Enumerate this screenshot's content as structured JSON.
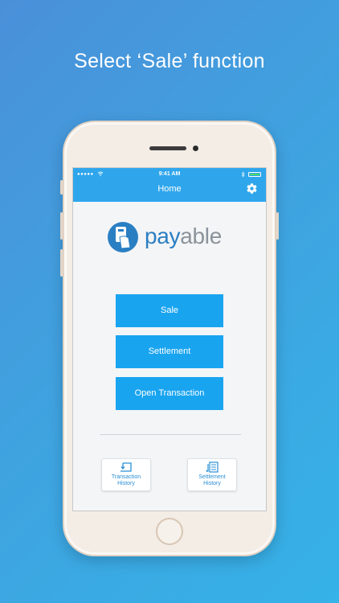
{
  "headline": "Select ‘Sale’ function",
  "status_bar": {
    "signal": "●●●●●",
    "time": "9:41 AM"
  },
  "navbar": {
    "title": "Home"
  },
  "logo": {
    "part1": "pay",
    "part2": "able"
  },
  "actions": {
    "sale": "Sale",
    "settlement": "Settlement",
    "open_transaction": "Open Transaction"
  },
  "tiles": {
    "transaction_history": "Transaction History",
    "settlement_history": "Settlement History"
  },
  "icons": {
    "settings": "gear-icon",
    "transaction_history": "refresh-doc-icon",
    "settlement_history": "list-doc-icon",
    "wifi": "wifi-icon",
    "bluetooth": "bluetooth-icon",
    "battery": "battery-icon"
  },
  "colors": {
    "accent": "#19a4f0",
    "navbar": "#2fa6ec",
    "logo_pay": "#2a7fc3",
    "logo_able": "#8b939b",
    "battery": "#4cd964"
  }
}
